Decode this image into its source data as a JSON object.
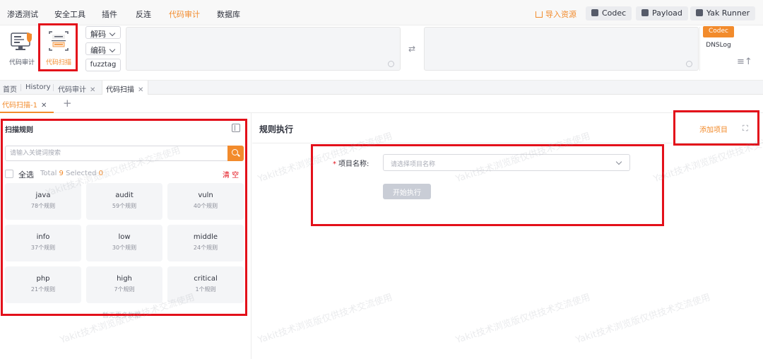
{
  "menu": {
    "items": [
      "渗透测试",
      "安全工具",
      "插件",
      "反连",
      "代码审计",
      "数据库"
    ],
    "active_index": 4,
    "import_label": "导入资源",
    "codec_label": "Codec",
    "payload_label": "Payload",
    "yak_runner_label": "Yak Runner"
  },
  "toolbar": {
    "code_audit_label": "代码审计",
    "code_scan_label": "代码扫描",
    "decode_label": "解码",
    "encode_label": "编码",
    "fuzztag_label": "fuzztag",
    "side_tabs": [
      "Codec",
      "DNSLog"
    ]
  },
  "tabs": {
    "row1": [
      {
        "label": "首页",
        "closable": false
      },
      {
        "label": "History",
        "closable": false
      },
      {
        "label": "代码审计",
        "closable": true
      },
      {
        "label": "代码扫描",
        "closable": true,
        "active": true
      }
    ],
    "row2_tab": "代码扫描-1"
  },
  "rules_panel": {
    "title": "扫描规则",
    "search_placeholder": "请输入关键词搜索",
    "select_all": "全选",
    "total_label": "Total",
    "total_value": "9",
    "selected_label": "Selected",
    "selected_value": "0",
    "clear_label": "清 空",
    "cards": [
      {
        "name": "java",
        "count": "78个规则"
      },
      {
        "name": "audit",
        "count": "59个规则"
      },
      {
        "name": "vuln",
        "count": "40个规则"
      },
      {
        "name": "info",
        "count": "37个规则"
      },
      {
        "name": "low",
        "count": "30个规则"
      },
      {
        "name": "middle",
        "count": "24个规则"
      },
      {
        "name": "php",
        "count": "21个规则"
      },
      {
        "name": "high",
        "count": "7个规则"
      },
      {
        "name": "critical",
        "count": "1个规则"
      }
    ],
    "no_more": "暂无更多数据"
  },
  "exec_panel": {
    "title": "规则执行",
    "add_project": "添加项目",
    "project_label": "项目名称:",
    "project_placeholder": "请选择项目名称",
    "start_button": "开始执行"
  },
  "watermark": "Yakit技术浏览版仅供技术交流使用",
  "colors": {
    "accent": "#f28b2c",
    "annotation_red": "#e3101a"
  }
}
